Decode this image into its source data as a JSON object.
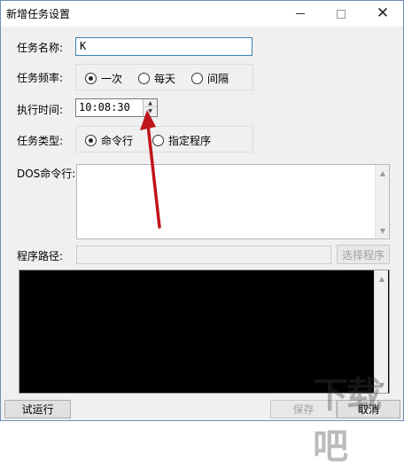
{
  "window": {
    "title": "新增任务设置"
  },
  "form": {
    "task_name_label": "任务名称:",
    "task_name_value": "K",
    "frequency_label": "任务频率:",
    "frequency_options": [
      "一次",
      "每天",
      "间隔"
    ],
    "frequency_selected": "一次",
    "exec_time_label": "执行时间:",
    "exec_time_value": "10:08:30",
    "task_type_label": "任务类型:",
    "task_type_options": [
      "命令行",
      "指定程序"
    ],
    "task_type_selected": "命令行",
    "dos_label": "DOS命令行:",
    "program_path_label": "程序路径:",
    "program_path_value": "",
    "select_program_button": "选择程序"
  },
  "footer": {
    "test_run_button": "试运行",
    "save_button": "保存",
    "cancel_button": "取消"
  },
  "watermark": {
    "text": "下载吧",
    "color": "#505050"
  },
  "annotation": {
    "arrow_color": "#c0141b"
  }
}
